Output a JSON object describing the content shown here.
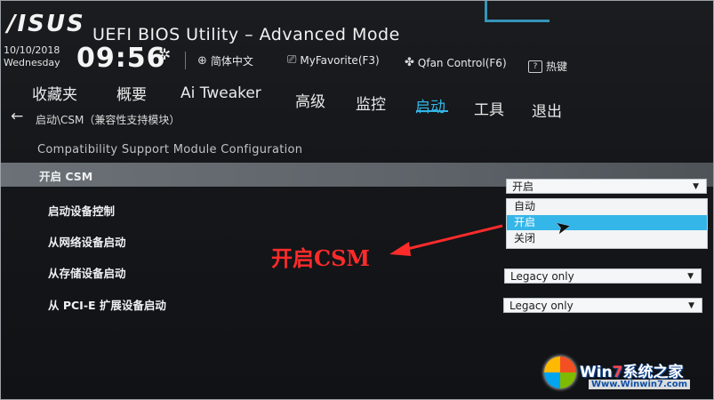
{
  "header": {
    "logo": "/ISUS",
    "title": "UEFI BIOS Utility – Advanced Mode",
    "date": "10/10/2018",
    "weekday": "Wednesday",
    "time": "09:56",
    "language": "简体中文",
    "myfavorite": "MyFavorite(F3)",
    "qfan": "Qfan Control(F6)",
    "hotkey": "热键",
    "hotkey_box": "?"
  },
  "tabs": [
    {
      "label": "收藏夹"
    },
    {
      "label": "概要"
    },
    {
      "label": "Ai Tweaker"
    },
    {
      "label": "高级"
    },
    {
      "label": "监控"
    },
    {
      "label": "启动"
    },
    {
      "label": "工具"
    },
    {
      "label": "退出"
    }
  ],
  "active_tab": "启动",
  "breadcrumb": "启动\\CSM（兼容性支持模块）",
  "section_title": "Compatibility Support Module Configuration",
  "settings": [
    {
      "label": "开启 CSM",
      "value": "开启"
    },
    {
      "label": "启动设备控制"
    },
    {
      "label": "从网络设备启动"
    },
    {
      "label": "从存储设备启动",
      "value": "Legacy only"
    },
    {
      "label": "从 PCI-E 扩展设备启动",
      "value": "Legacy only"
    }
  ],
  "dropdown_options": [
    {
      "label": "自动"
    },
    {
      "label": "开启",
      "selected": true
    },
    {
      "label": "关闭"
    }
  ],
  "annotation": "开启CSM",
  "watermark": {
    "brand_prefix": "Win",
    "brand_seven": "7",
    "brand_suffix": "系统之家",
    "url": "Www.Winwin7.com"
  },
  "colors": {
    "accent": "#33b5e5",
    "highlight_row": "#5d6368",
    "annotation": "#ff2b2b"
  }
}
